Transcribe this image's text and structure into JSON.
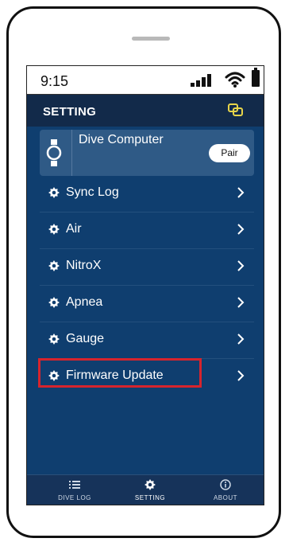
{
  "status_bar": {
    "time": "9:15"
  },
  "header": {
    "title": "SETTING"
  },
  "device_card": {
    "name": "Dive Computer",
    "pair_label": "Pair"
  },
  "menu": {
    "items": [
      {
        "label": "Sync Log"
      },
      {
        "label": "Air"
      },
      {
        "label": "NitroX"
      },
      {
        "label": "Apnea"
      },
      {
        "label": "Gauge"
      },
      {
        "label": "Firmware Update",
        "highlighted": true
      }
    ]
  },
  "tabs": [
    {
      "label": "DIVE LOG",
      "icon": "list-icon"
    },
    {
      "label": "SETTING",
      "icon": "gear-icon",
      "active": true
    },
    {
      "label": "ABOUT",
      "icon": "info-icon"
    }
  ],
  "colors": {
    "accent_icon": "#e6d44a",
    "highlight_border": "#d6242d",
    "background": "#0f3e6f"
  }
}
